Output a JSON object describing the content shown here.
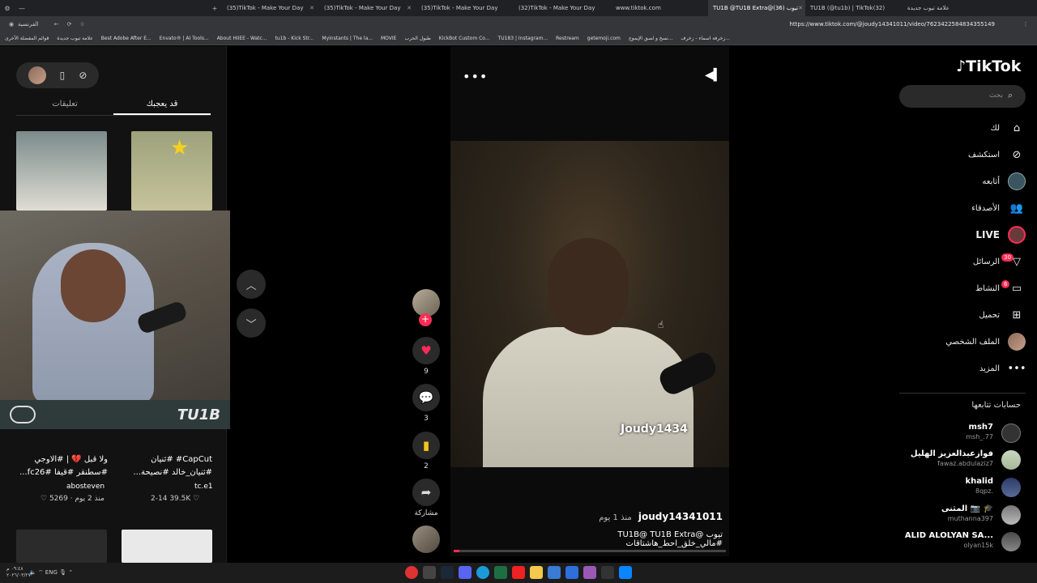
{
  "browser": {
    "tabs": [
      "(35)TikTok - Make Your Day",
      "(35)TikTok - Make Your Day",
      "(35)TikTok - Make Your Day",
      "(32)TikTok - Make Your Day",
      "www.tiktok.com",
      "TU1B @TU1B Extra@(36) تيوب",
      "TU1B (@tu1b) | TikTok(32)",
      "علامة تيوب جديدة"
    ],
    "url": "https://www.tiktok.com/@joudy14341011/video/7623422584834355149",
    "bookmarks_label": "الفرنسية",
    "bookmarks": [
      "قوائم المفضلة الأخرى",
      "علامة تيوب جديدة",
      "Best Adobe After E...",
      "Envato® | AI Tools...",
      "About HIIEE - Watc...",
      "tu1b - Kick Str...",
      "Myinstants | The la...",
      "MOVIE",
      "طبول الحرب",
      "KickBot Custom Co...",
      "TU183 | Instagram...",
      "Restream",
      "getemoji.com",
      "نسخ و لصق الإيموج...",
      "زخرفة اسماء - زخرف..."
    ]
  },
  "left_panel": {
    "tabs": [
      "قد يعجبك",
      "تعليقات"
    ],
    "items": [
      {
        "caption": "ولا قبل 💔 | #الاوجي #سطنقر #قيفا #fc26...",
        "author": "abosteven",
        "date": "منذ 2 يوم",
        "likes": "5269"
      },
      {
        "caption": "CapCut# #ثنيان #ثنيان_خالد #نصيحة...",
        "author": "tc.e1",
        "date": "2-14",
        "likes": "39.5K"
      }
    ],
    "webcam_logo": "TU1B"
  },
  "video": {
    "watermark": "Joudy1434",
    "author": "joudy14341011",
    "time_ago": "منذ 1 يوم",
    "description": "TU1B@ TU1B Extra@ تيوب #مالي_خلق_احط_هاشتاقات",
    "progress": 0.02,
    "likes": "9",
    "comments": "3",
    "saves": "2",
    "share_label": "مشاركة"
  },
  "sidebar": {
    "brand": "TikTok",
    "search_placeholder": "بحث",
    "nav": [
      {
        "label": "لك",
        "icon": "home-icon"
      },
      {
        "label": "استكشف",
        "icon": "compass-icon"
      },
      {
        "label": "أتابعه",
        "icon": "following-icon"
      },
      {
        "label": "الأصدقاء",
        "icon": "friends-icon"
      },
      {
        "label": "LIVE",
        "icon": "live-icon"
      },
      {
        "label": "الرسائل",
        "icon": "messages-icon",
        "badge": "30"
      },
      {
        "label": "النشاط",
        "icon": "activity-icon",
        "badge": "6"
      },
      {
        "label": "تحميل",
        "icon": "upload-icon"
      },
      {
        "label": "الملف الشخصي",
        "icon": "profile-icon"
      },
      {
        "label": "المزيد",
        "icon": "more-icon"
      }
    ],
    "following_title": "حسابات تتابعها",
    "following": [
      {
        "name": "msh7",
        "handle": "msh_.77"
      },
      {
        "name": "فوازعبدالعزيز الهليل",
        "handle": "fawaz.abdulaziz7"
      },
      {
        "name": "khalid",
        "handle": "8qpz."
      },
      {
        "name": "المثنى 📷 🎓",
        "handle": "muthanna397"
      },
      {
        "name": "ALID ALOLYAN SA...",
        "handle": "olyan15k"
      }
    ]
  },
  "taskbar": {
    "lang": "ENG",
    "time": "٠٩:٤٨ م",
    "date": "٢٠٢٦/٠٣/٢٧"
  },
  "colors": {
    "accent": "#fe2c55",
    "bookmark": "#f5c518",
    "bg": "#000000"
  }
}
